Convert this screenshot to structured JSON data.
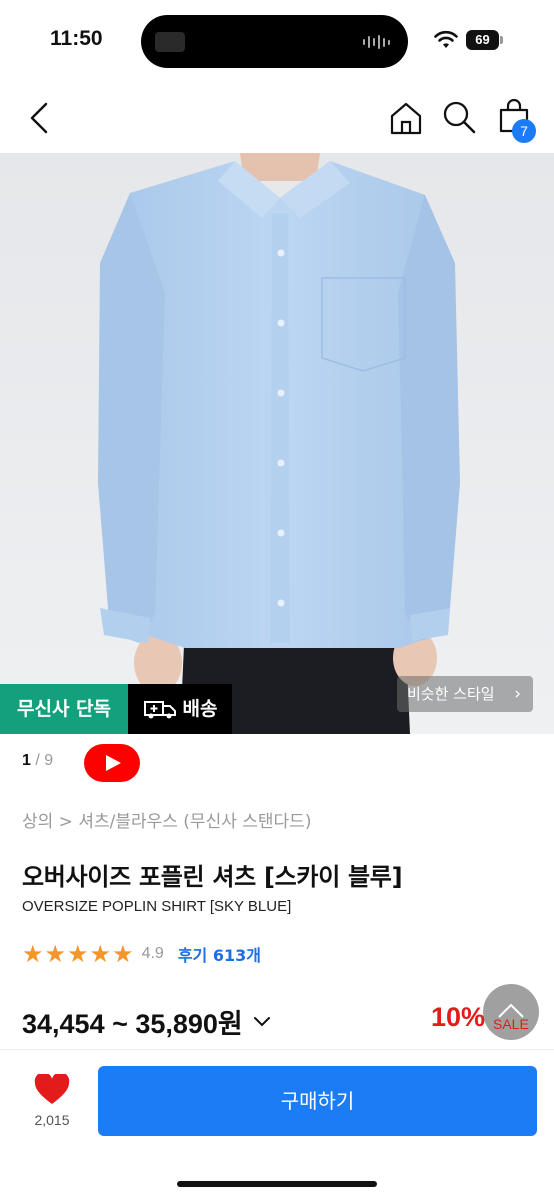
{
  "status_bar": {
    "time": "11:50",
    "battery": "69"
  },
  "header": {
    "cart_count": "7"
  },
  "image": {
    "badge_exclusive": "무신사 단독",
    "badge_delivery": "배송",
    "similar_style": "비슷한 스타일"
  },
  "pager": {
    "current": "1",
    "total": "/ 9"
  },
  "breadcrumb": "상의 > 셔츠/블라우스 (무신사 스탠다드)",
  "product": {
    "title": "오버사이즈 포플린 셔츠 [스카이 블루]",
    "subtitle": "OVERSIZE POPLIN SHIRT [SKY BLUE]",
    "rating": "4.9",
    "reviews": "후기 613개",
    "stars": 5,
    "price": "34,454 ~ 35,890원",
    "discount": "10%",
    "sale_label": "SALE"
  },
  "footer": {
    "wish_count": "2,015",
    "buy_label": "구매하기"
  },
  "colors": {
    "accent": "#1b7cf5",
    "exclusive": "#13a07c",
    "discount": "#e31b1b",
    "star": "#f5962a"
  }
}
